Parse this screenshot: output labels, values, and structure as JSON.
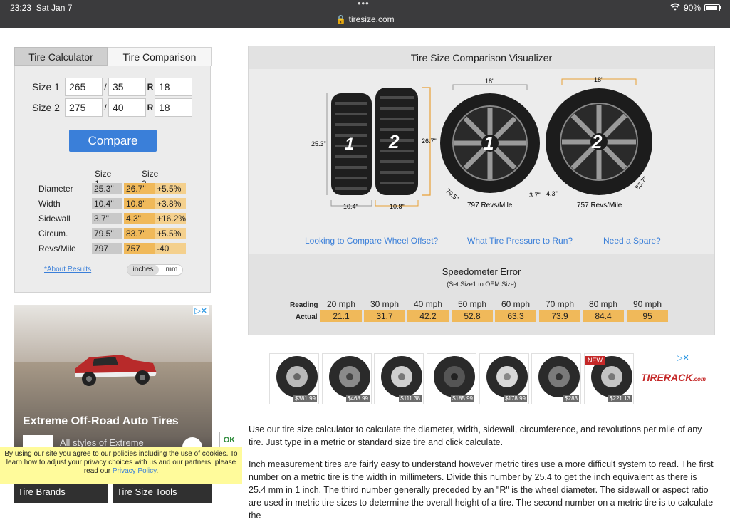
{
  "status_bar": {
    "time": "23:23",
    "date": "Sat Jan 7",
    "url": "tiresize.com",
    "battery": "90%"
  },
  "calculator": {
    "tabs": [
      "Tire Calculator",
      "Tire Comparison"
    ],
    "size1": {
      "label": "Size 1",
      "width": "265",
      "ratio": "35",
      "r": "R",
      "rim": "18"
    },
    "size2": {
      "label": "Size 2",
      "width": "275",
      "ratio": "40",
      "r": "R",
      "rim": "18"
    },
    "slash": "/",
    "compare_label": "Compare",
    "results_header": {
      "s1": "Size 1",
      "s2": "Size 2"
    },
    "results": [
      {
        "name": "Diameter",
        "s1": "25.3\"",
        "s2": "26.7\"",
        "diff": "+5.5%"
      },
      {
        "name": "Width",
        "s1": "10.4\"",
        "s2": "10.8\"",
        "diff": "+3.8%"
      },
      {
        "name": "Sidewall",
        "s1": "3.7\"",
        "s2": "4.3\"",
        "diff": "+16.2%"
      },
      {
        "name": "Circum.",
        "s1": "79.5\"",
        "s2": "83.7\"",
        "diff": "+5.5%"
      },
      {
        "name": "Revs/Mile",
        "s1": "797",
        "s2": "757",
        "diff": "-40"
      }
    ],
    "about_link": "*About Results",
    "units": {
      "a": "inches",
      "b": "mm"
    }
  },
  "ad_left": {
    "title": "Extreme Off-Road Auto Tires",
    "sub": "All styles of Extreme"
  },
  "cookie": {
    "text": "By using our site you agree to our policies including the use of cookies. To learn how to adjust your privacy choices with us and our partners, please read our",
    "link": "Privacy Policy",
    "ok": "OK"
  },
  "bottom_buttons": [
    "Tire Brands",
    "Tire Size Tools"
  ],
  "visualizer": {
    "title": "Tire Size Comparison Visualizer",
    "dims": {
      "d1": "25.3\"",
      "d2": "26.7\"",
      "w1": "10.4\"",
      "w2": "10.8\"",
      "rim1": "18\"",
      "rim2": "18\"",
      "side1": "3.7\"",
      "side2": "4.3\"",
      "circ1": "79.5\"",
      "circ2": "83.7\"",
      "revs1": "797 Revs/Mile",
      "revs2": "757 Revs/Mile",
      "n1": "1",
      "n2": "2"
    },
    "links": [
      "Looking to Compare Wheel Offset?",
      "What Tire Pressure to Run?",
      "Need a Spare?"
    ]
  },
  "speedo": {
    "title": "Speedometer Error",
    "subtitle": "(Set Size1 to OEM Size)",
    "reading_label": "Reading",
    "actual_label": "Actual",
    "readings": [
      "20 mph",
      "30 mph",
      "40 mph",
      "50 mph",
      "60 mph",
      "70 mph",
      "80 mph",
      "90 mph"
    ],
    "actuals": [
      "21.1",
      "31.7",
      "42.2",
      "52.8",
      "63.3",
      "73.9",
      "84.4",
      "95"
    ]
  },
  "tire_ad": {
    "prices": [
      "$381.99",
      "$468.99",
      "$111.38",
      "$185.99",
      "$178.99",
      "$283",
      "$221.13"
    ],
    "new_badge": "NEW",
    "brand": "TIRERACK",
    "brand_sub": ".com"
  },
  "paragraphs": {
    "p1": "Use our tire size calculator to calculate the diameter, width, sidewall, circumference, and revolutions per mile of any tire. Just type in a metric or standard size tire and click calculate.",
    "p2": "Inch measurement tires are fairly easy to understand however metric tires use a more difficult system to read. The first number on a metric tire is the width in millimeters. Divide this number by 25.4 to get the inch equivalent as there is 25.4 mm in 1 inch. The third number generally preceded by an \"R\" is the wheel diameter. The sidewall or aspect ratio are used in metric tire sizes to determine the overall height of a tire. The second number on a metric tire is to calculate the"
  },
  "colors": {
    "accent": "#3a7fd9",
    "size2": "#f0b95a",
    "diff": "#f4d08d",
    "size1": "#c9c9c9",
    "cookie": "#fffb9b"
  }
}
